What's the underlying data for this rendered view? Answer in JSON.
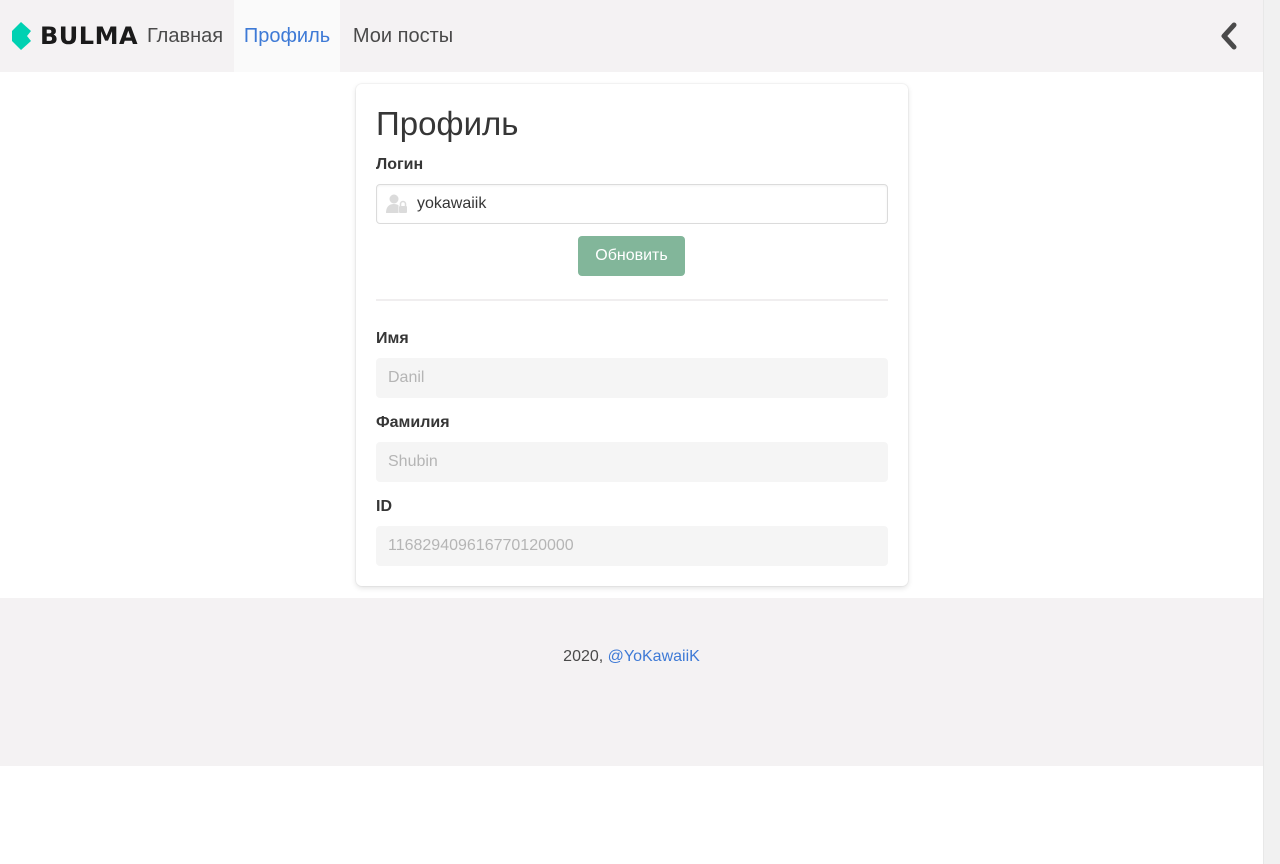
{
  "navbar": {
    "brand": "BULMA",
    "brand_color": "#00d1b2",
    "items": [
      {
        "label": "Главная",
        "active": false
      },
      {
        "label": "Профиль",
        "active": true
      },
      {
        "label": "Мои посты",
        "active": false
      }
    ],
    "back_icon": "chevron-left-icon"
  },
  "profile": {
    "title": "Профиль",
    "login_label": "Логин",
    "login_value": "yokawaiik",
    "login_icon": "user-lock-icon",
    "update_button": "Обновить",
    "button_color": "#82b69a",
    "first_name_label": "Имя",
    "first_name_placeholder": "Danil",
    "last_name_label": "Фамилия",
    "last_name_placeholder": "Shubin",
    "id_label": "ID",
    "id_placeholder": "116829409616770120000"
  },
  "footer": {
    "year_text": "2020, ",
    "link_text": "@YoKawaiiK",
    "link_color": "#3e7ad6"
  }
}
